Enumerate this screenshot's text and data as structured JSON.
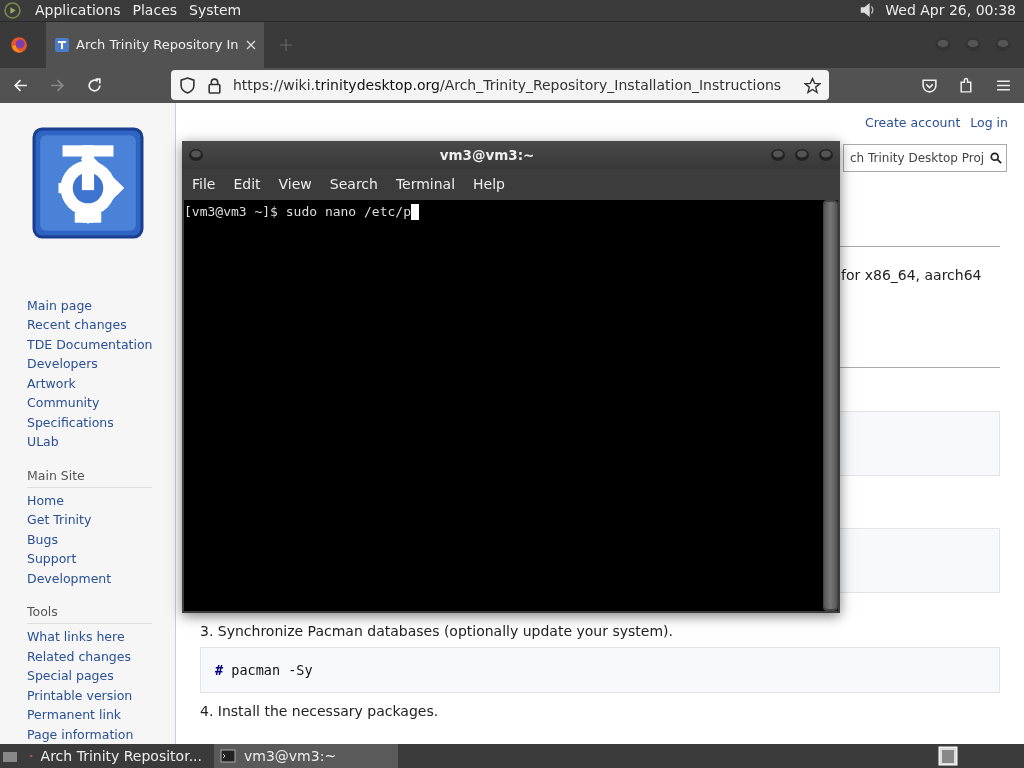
{
  "top_panel": {
    "menus": [
      "Applications",
      "Places",
      "System"
    ],
    "clock": "Wed Apr 26, 00:38"
  },
  "browser": {
    "tabs": [
      {
        "title": "Arch Trinity Repository In",
        "selected": true
      }
    ],
    "url_host": "https://wiki.",
    "url_domain": "trinitydesktop.org",
    "url_path": "/Arch_Trinity_Repository_Installation_Instructions"
  },
  "wiki": {
    "account_links": [
      "Create account",
      "Log in"
    ],
    "search": {
      "placeholder": "ch Trinity Desktop Proj"
    },
    "sidebar": [
      {
        "items": [
          "Main page",
          "Recent changes",
          "TDE Documentation",
          "Developers",
          "Artwork",
          "Community",
          "Specifications",
          "ULab"
        ]
      },
      {
        "heading": "Main Site",
        "items": [
          "Home",
          "Get Trinity",
          "Bugs",
          "Support",
          "Development"
        ]
      },
      {
        "heading": "Tools",
        "items": [
          "What links here",
          "Related changes",
          "Special pages",
          "Printable version",
          "Permanent link",
          "Page information"
        ]
      }
    ],
    "fragment": "for x86_64, aarch64",
    "step3": "3. Synchronize Pacman databases (optionally update your system).",
    "code": {
      "prompt": "#",
      "command": "pacman -Sy"
    },
    "step4": "4. Install the necessary packages."
  },
  "terminal": {
    "title": "vm3@vm3:~",
    "menu": [
      "File",
      "Edit",
      "View",
      "Search",
      "Terminal",
      "Help"
    ],
    "lines": [
      "[vm3@vm3 ~]$ sudo nano /etc/p"
    ]
  },
  "taskbar": {
    "tasks": [
      {
        "kind": "browser",
        "label": "Arch Trinity Repositor...",
        "selected": false
      },
      {
        "kind": "terminal",
        "label": "vm3@vm3:~",
        "selected": true
      }
    ]
  }
}
